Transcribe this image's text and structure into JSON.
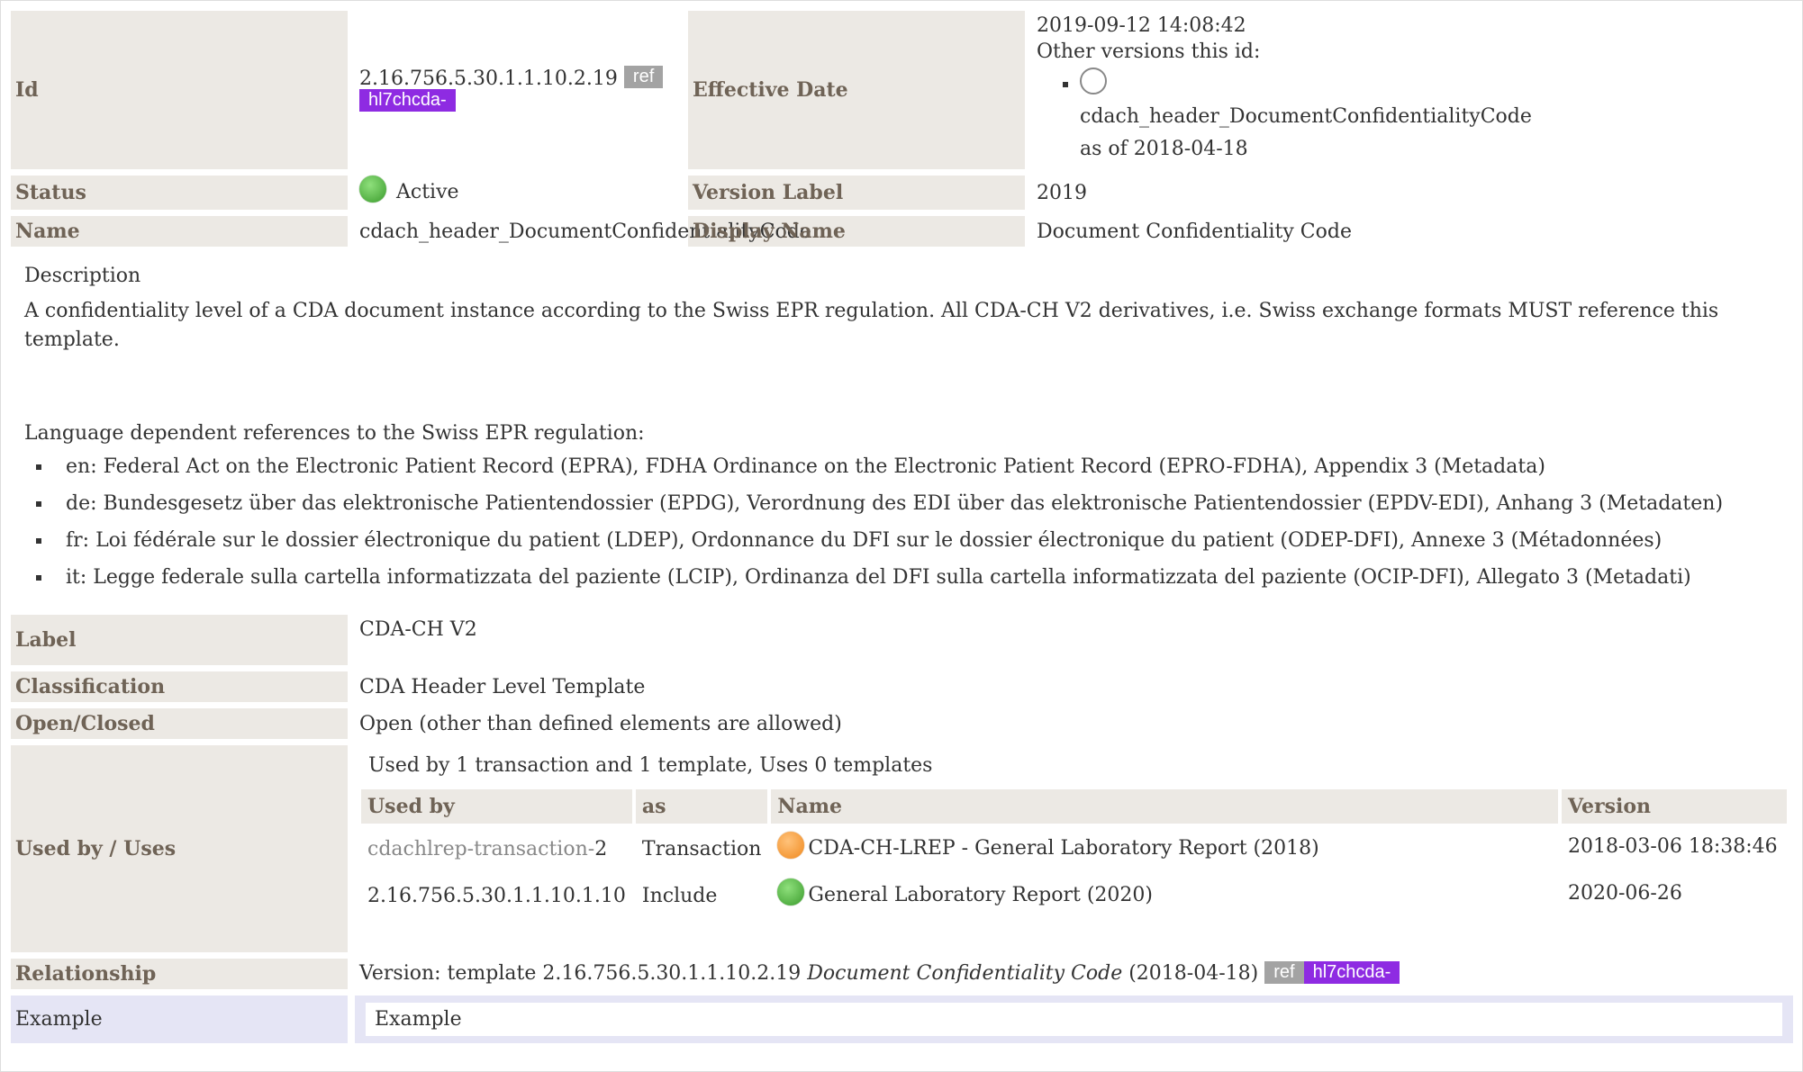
{
  "header": {
    "id_label": "Id",
    "id_value": "2.16.756.5.30.1.1.10.2.19",
    "ref_badge": "ref",
    "prefix_badge": "hl7chcda-",
    "effective_date_label": "Effective Date",
    "effective_date_value": "2019-09-12 14:08:42",
    "other_versions_label": "Other versions this id:",
    "other_version_name": "cdach_header_DocumentConfidentialityCode",
    "other_version_date": "as of 2018-04-18",
    "status_label": "Status",
    "status_value": "Active",
    "version_label_label": "Version Label",
    "version_label_value": "2019",
    "name_label": "Name",
    "name_value": "cdach_header_DocumentConfidentialityCode",
    "display_name_label": "Display Name",
    "display_name_value": "Document Confidentiality Code"
  },
  "description": {
    "title": "Description",
    "text": "A confidentiality level of a CDA document instance according to the Swiss EPR regulation. All CDA-CH V2 derivatives, i.e. Swiss exchange formats MUST reference this template.",
    "refs_intro": "Language dependent references to the Swiss EPR regulation:",
    "refs": [
      "en: Federal Act on the Electronic Patient Record (EPRA), FDHA Ordinance on the Electronic Patient Record (EPRO-FDHA), Appendix 3 (Metadata)",
      "de: Bundesgesetz über das elektronische Patientendossier (EPDG), Verordnung des EDI über das elektronische Patientendossier (EPDV-EDI), Anhang 3 (Metadaten)",
      "fr: Loi fédérale sur le dossier électronique du patient (LDEP), Ordonnance du DFI sur le dossier électronique du patient (ODEP-DFI), Annexe 3 (Métadonnées)",
      "it: Legge federale sulla cartella informatizzata del paziente (LCIP), Ordinanza del DFI sulla cartella informatizzata del paziente (OCIP-DFI), Allegato 3 (Metadati)"
    ]
  },
  "details": {
    "label_label": "Label",
    "label_value": "CDA-CH V2",
    "classification_label": "Classification",
    "classification_value": "CDA Header Level Template",
    "open_closed_label": "Open/Closed",
    "open_closed_value": "Open (other than defined elements are allowed)",
    "used_by_label": "Used by / Uses",
    "used_by_summary": "Used by 1 transaction and 1 template, Uses 0 templates",
    "used_by_columns": [
      "Used by",
      "as",
      "Name",
      "Version"
    ],
    "used_by_rows": [
      {
        "id_prefix": "cdachlrep-transaction-",
        "id_suffix": "2",
        "as": "Transaction",
        "status_color": "orange",
        "name": "CDA-CH-LREP - General Laboratory Report (2018)",
        "version": "2018-03-06 18:38:46"
      },
      {
        "id_prefix": "",
        "id_suffix": "2.16.756.5.30.1.1.10.1.10",
        "as": "Include",
        "status_color": "green",
        "name": "General Laboratory Report (2020)",
        "version": "2020-06-26"
      }
    ],
    "relationship_label": "Relationship",
    "relationship_prefix": "Version: template 2.16.756.5.30.1.1.10.2.19 ",
    "relationship_italic": "Document Confidentiality Code",
    "relationship_suffix": " (2018-04-18)",
    "relationship_ref_badge": "ref",
    "relationship_prefix_badge": "hl7chcda-",
    "example_label": "Example",
    "example_value": "Example"
  }
}
